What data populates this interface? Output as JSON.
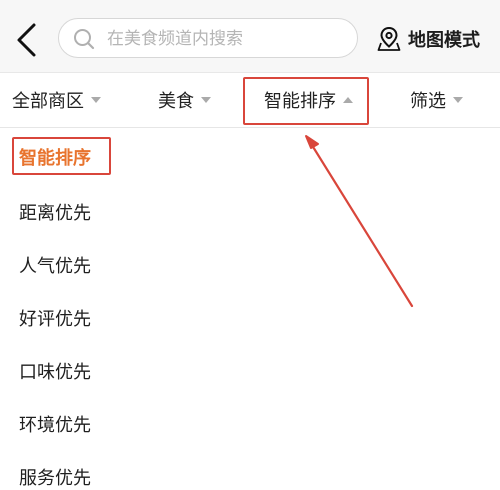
{
  "header": {
    "back_icon": "chevron-left-icon",
    "search_icon": "search-icon",
    "search_placeholder": "在美食频道内搜索",
    "map_icon": "map-pin-icon",
    "map_mode_label": "地图模式"
  },
  "filter_tabs": [
    {
      "label": "全部商区",
      "caret": "down"
    },
    {
      "label": "美食",
      "caret": "down"
    },
    {
      "label": "智能排序",
      "caret": "up",
      "active": true
    },
    {
      "label": "筛选",
      "caret": "down"
    }
  ],
  "sort_options": [
    {
      "label": "智能排序",
      "selected": true
    },
    {
      "label": "距离优先"
    },
    {
      "label": "人气优先"
    },
    {
      "label": "好评优先"
    },
    {
      "label": "口味优先"
    },
    {
      "label": "环境优先"
    },
    {
      "label": "服务优先"
    }
  ],
  "colors": {
    "highlight_red": "#d9463b",
    "selected_orange": "#e8742e"
  }
}
